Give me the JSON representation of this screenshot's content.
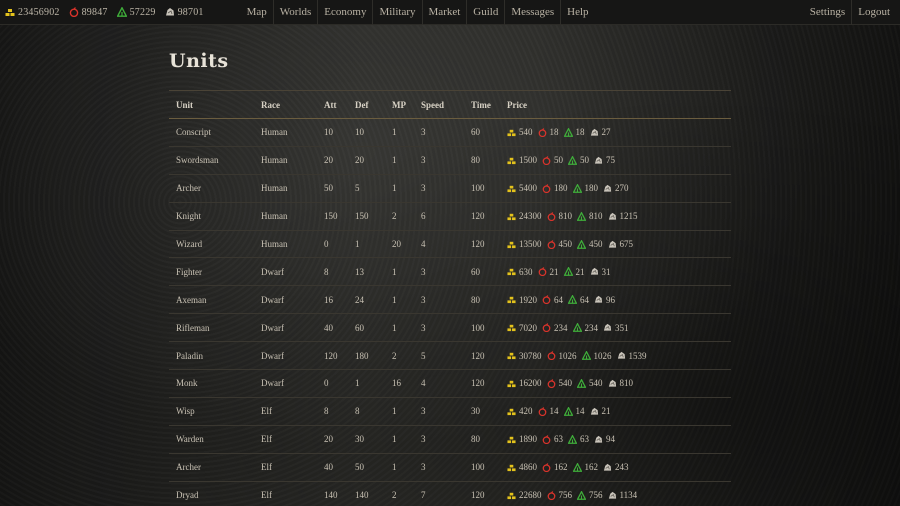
{
  "resources": [
    {
      "icon": "gold-icon",
      "value": "23456902"
    },
    {
      "icon": "food-icon",
      "value": "89847"
    },
    {
      "icon": "wood-icon",
      "value": "57229"
    },
    {
      "icon": "stone-icon",
      "value": "98701"
    }
  ],
  "nav": [
    "Map",
    "Worlds",
    "Economy",
    "Military",
    "Market",
    "Guild",
    "Messages",
    "Help"
  ],
  "nav_right": [
    "Settings",
    "Logout"
  ],
  "page_title": "Units",
  "columns": [
    "Unit",
    "Race",
    "Att",
    "Def",
    "MP",
    "Speed",
    "Time",
    "Price"
  ],
  "colors": {
    "gold": "#e3c21c",
    "food": "#d9332b",
    "wood": "#3fae3a",
    "stone": "#c9c4ba"
  },
  "units": [
    {
      "unit": "Conscript",
      "race": "Human",
      "att": "10",
      "def": "10",
      "mp": "1",
      "speed": "3",
      "time": "60",
      "price": [
        "540",
        "18",
        "18",
        "27"
      ]
    },
    {
      "unit": "Swordsman",
      "race": "Human",
      "att": "20",
      "def": "20",
      "mp": "1",
      "speed": "3",
      "time": "80",
      "price": [
        "1500",
        "50",
        "50",
        "75"
      ]
    },
    {
      "unit": "Archer",
      "race": "Human",
      "att": "50",
      "def": "5",
      "mp": "1",
      "speed": "3",
      "time": "100",
      "price": [
        "5400",
        "180",
        "180",
        "270"
      ]
    },
    {
      "unit": "Knight",
      "race": "Human",
      "att": "150",
      "def": "150",
      "mp": "2",
      "speed": "6",
      "time": "120",
      "price": [
        "24300",
        "810",
        "810",
        "1215"
      ]
    },
    {
      "unit": "Wizard",
      "race": "Human",
      "att": "0",
      "def": "1",
      "mp": "20",
      "speed": "4",
      "time": "120",
      "price": [
        "13500",
        "450",
        "450",
        "675"
      ]
    },
    {
      "unit": "Fighter",
      "race": "Dwarf",
      "att": "8",
      "def": "13",
      "mp": "1",
      "speed": "3",
      "time": "60",
      "price": [
        "630",
        "21",
        "21",
        "31"
      ]
    },
    {
      "unit": "Axeman",
      "race": "Dwarf",
      "att": "16",
      "def": "24",
      "mp": "1",
      "speed": "3",
      "time": "80",
      "price": [
        "1920",
        "64",
        "64",
        "96"
      ]
    },
    {
      "unit": "Rifleman",
      "race": "Dwarf",
      "att": "40",
      "def": "60",
      "mp": "1",
      "speed": "3",
      "time": "100",
      "price": [
        "7020",
        "234",
        "234",
        "351"
      ]
    },
    {
      "unit": "Paladin",
      "race": "Dwarf",
      "att": "120",
      "def": "180",
      "mp": "2",
      "speed": "5",
      "time": "120",
      "price": [
        "30780",
        "1026",
        "1026",
        "1539"
      ]
    },
    {
      "unit": "Monk",
      "race": "Dwarf",
      "att": "0",
      "def": "1",
      "mp": "16",
      "speed": "4",
      "time": "120",
      "price": [
        "16200",
        "540",
        "540",
        "810"
      ]
    },
    {
      "unit": "Wisp",
      "race": "Elf",
      "att": "8",
      "def": "8",
      "mp": "1",
      "speed": "3",
      "time": "30",
      "price": [
        "420",
        "14",
        "14",
        "21"
      ]
    },
    {
      "unit": "Warden",
      "race": "Elf",
      "att": "20",
      "def": "30",
      "mp": "1",
      "speed": "3",
      "time": "80",
      "price": [
        "1890",
        "63",
        "63",
        "94"
      ]
    },
    {
      "unit": "Archer",
      "race": "Elf",
      "att": "40",
      "def": "50",
      "mp": "1",
      "speed": "3",
      "time": "100",
      "price": [
        "4860",
        "162",
        "162",
        "243"
      ]
    },
    {
      "unit": "Dryad",
      "race": "Elf",
      "att": "140",
      "def": "140",
      "mp": "2",
      "speed": "7",
      "time": "120",
      "price": [
        "22680",
        "756",
        "756",
        "1134"
      ]
    }
  ]
}
